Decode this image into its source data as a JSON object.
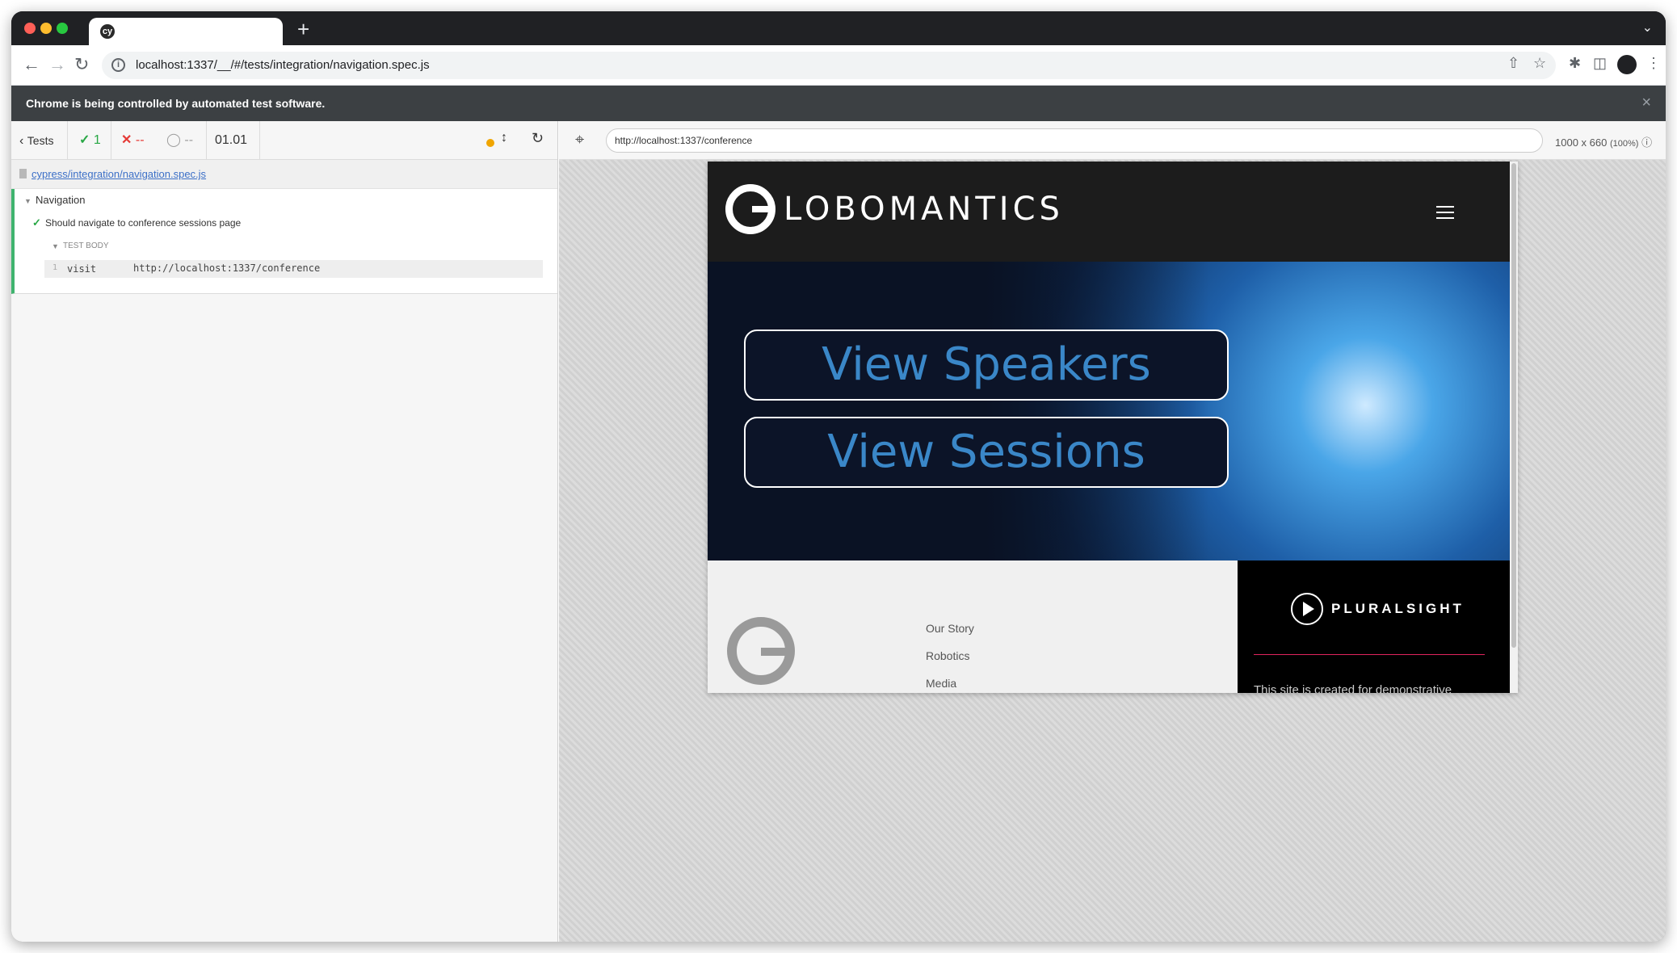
{
  "browser": {
    "tab_favicon": "cy",
    "address": "localhost:1337/__/#/tests/integration/navigation.spec.js",
    "automation_banner": "Chrome is being controlled by automated test software."
  },
  "reporter": {
    "back_label": "Tests",
    "passed": "1",
    "failed": "--",
    "pending": "--",
    "duration": "01.01",
    "spec_path": "cypress/integration/navigation.spec.js",
    "suite_title": "Navigation",
    "test_title": "Should navigate to conference sessions page",
    "test_body_label": "TEST BODY",
    "command": {
      "number": "1",
      "name": "visit",
      "message": "http://localhost:1337/conference"
    }
  },
  "aut": {
    "url": "http://localhost:1337/conference",
    "viewport": "1000 x 660",
    "scale": "(100%)"
  },
  "site": {
    "logo_text": "LOBOMANTICS",
    "btn_speakers": "View Speakers",
    "btn_sessions": "View Sessions",
    "footer_links": [
      "Our Story",
      "Robotics",
      "Media"
    ],
    "sponsor": "PLURALSIGHT",
    "sponsor_text": "This site is created for demonstrative"
  },
  "colors": {
    "pass": "#28a745",
    "fail": "#e53935",
    "pending_dot": "#f0a500",
    "link": "#3b6fc7",
    "site_button_text": "#3a87c8"
  }
}
